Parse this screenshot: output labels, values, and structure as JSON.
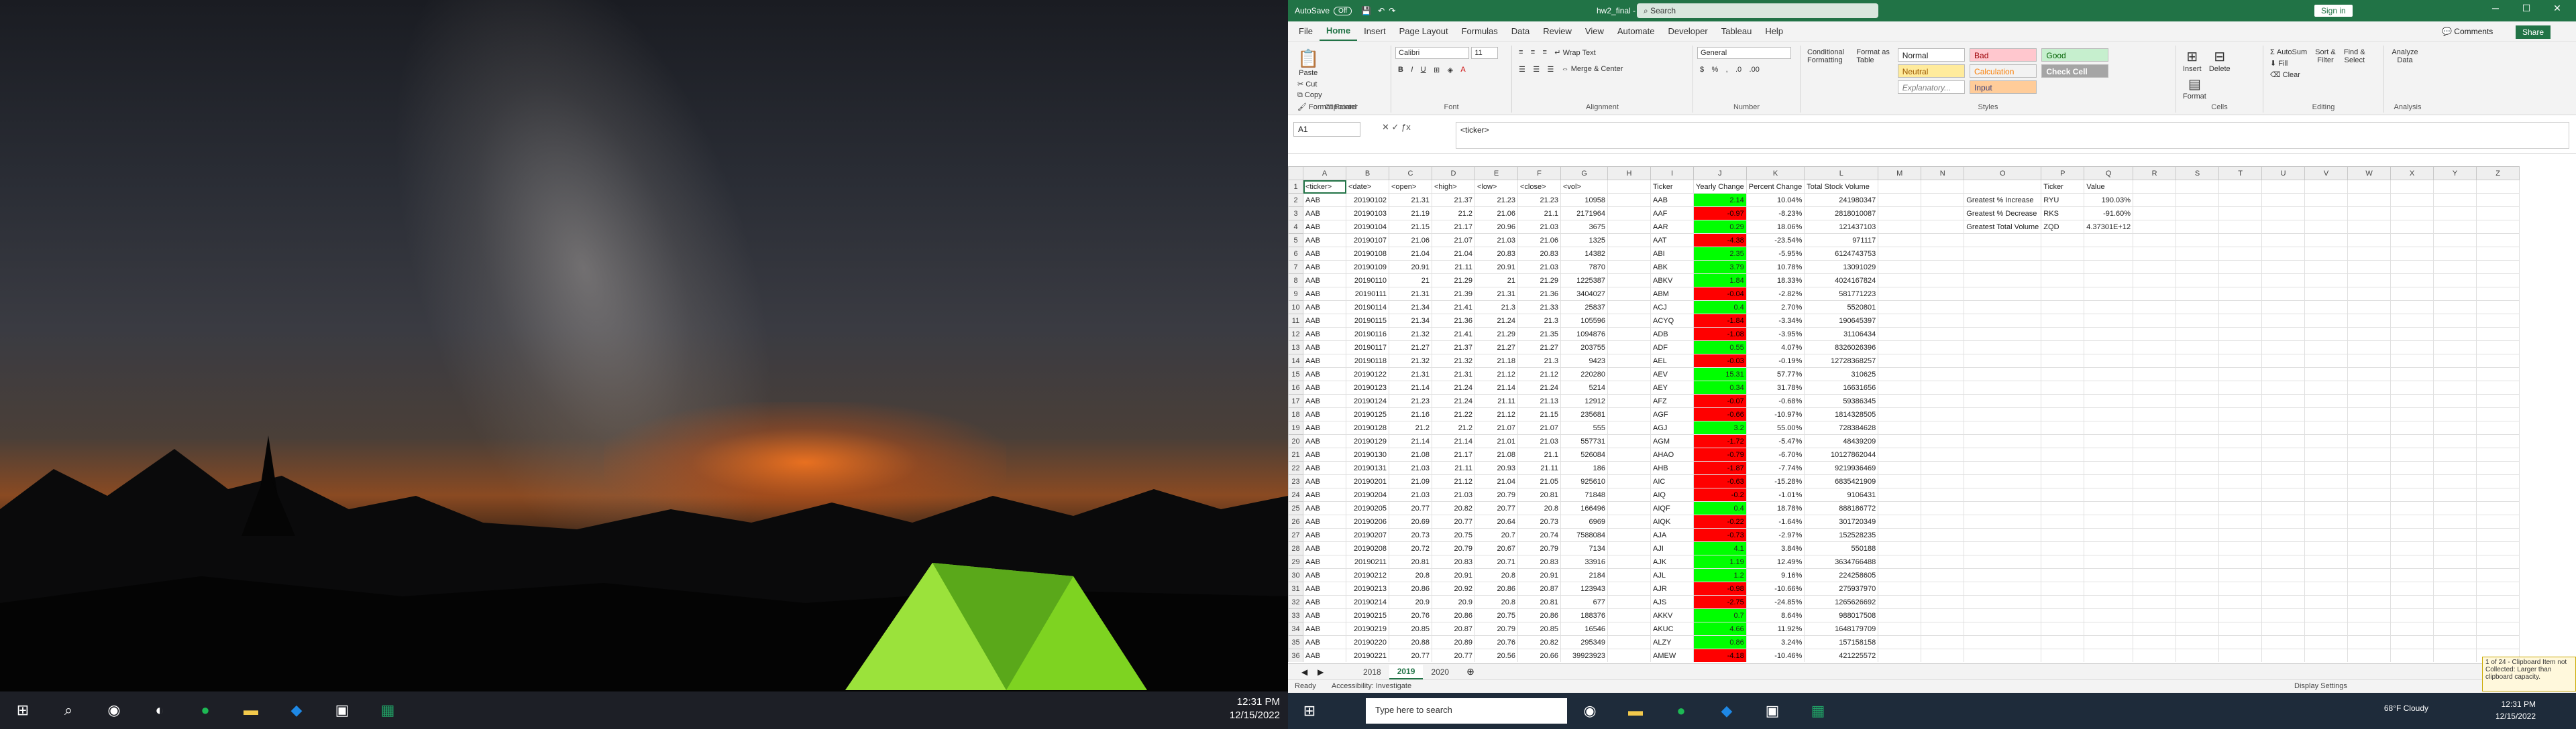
{
  "desktop": {
    "clock_time": "12:31 PM",
    "clock_date": "12/15/2022"
  },
  "excel": {
    "autosave_label": "AutoSave",
    "autosave_state": "Off",
    "filename": "hw2_final - Saved",
    "search_placeholder": "Search",
    "signin_label": "Sign in",
    "menu": [
      "File",
      "Home",
      "Insert",
      "Page Layout",
      "Formulas",
      "Data",
      "Review",
      "View",
      "Automate",
      "Developer",
      "Tableau",
      "Help"
    ],
    "comments_label": "Comments",
    "share_label": "Share",
    "ribbon": {
      "paste": "Paste",
      "cut": "Cut",
      "copy": "Copy",
      "format_painter": "Format Painter",
      "clipboard_group": "Clipboard",
      "font_name": "Calibri",
      "font_size": "11",
      "font_group": "Font",
      "wrap_text": "Wrap Text",
      "merge_center": "Merge & Center",
      "alignment_group": "Alignment",
      "number_format": "General",
      "number_group": "Number",
      "cond_format": "Conditional Formatting",
      "format_table": "Format as Table",
      "cell_styles": [
        "Normal",
        "Bad",
        "Good",
        "Neutral",
        "Calculation",
        "Check Cell",
        "Explanatory...",
        "Input"
      ],
      "styles_group": "Styles",
      "insert": "Insert",
      "delete": "Delete",
      "format": "Format",
      "cells_group": "Cells",
      "autosum": "AutoSum",
      "fill": "Fill",
      "clear": "Clear",
      "sort_filter": "Sort & Filter",
      "find_select": "Find & Select",
      "editing_group": "Editing",
      "analyze": "Analyze Data",
      "analysis_group": "Analysis"
    },
    "name_box": "A1",
    "formula": "<ticker>",
    "columns": [
      "A",
      "B",
      "C",
      "D",
      "E",
      "F",
      "G",
      "H",
      "I",
      "J",
      "K",
      "L",
      "M",
      "N",
      "O",
      "P",
      "Q",
      "R",
      "S",
      "T",
      "U",
      "V",
      "W",
      "X",
      "Y",
      "Z"
    ],
    "headers": [
      "<ticker>",
      "<date>",
      "<open>",
      "<high>",
      "<low>",
      "<close>",
      "<vol>",
      "",
      "Ticker",
      "Yearly Change",
      "Percent Change",
      "Total Stock Volume",
      "",
      "",
      "",
      "Ticker",
      "Value"
    ],
    "rows": [
      [
        "AAB",
        "20190102",
        "21.31",
        "21.37",
        "21.23",
        "21.23",
        "10958",
        "AAB",
        "2.14",
        "10.04%",
        "241980347"
      ],
      [
        "AAB",
        "20190103",
        "21.19",
        "21.2",
        "21.06",
        "21.1",
        "2171964",
        "AAF",
        "-0.97",
        "-8.23%",
        "2818010087"
      ],
      [
        "AAB",
        "20190104",
        "21.15",
        "21.17",
        "20.96",
        "21.03",
        "3675",
        "AAR",
        "0.29",
        "18.06%",
        "121437103"
      ],
      [
        "AAB",
        "20190107",
        "21.06",
        "21.07",
        "21.03",
        "21.06",
        "1325",
        "AAT",
        "-4.38",
        "-23.54%",
        "971117"
      ],
      [
        "AAB",
        "20190108",
        "21.04",
        "21.04",
        "20.83",
        "20.83",
        "14382",
        "ABI",
        "2.35",
        "-5.95%",
        "6124743753"
      ],
      [
        "AAB",
        "20190109",
        "20.91",
        "21.11",
        "20.91",
        "21.03",
        "7870",
        "ABK",
        "3.79",
        "10.78%",
        "13091029"
      ],
      [
        "AAB",
        "20190110",
        "21",
        "21.29",
        "21",
        "21.29",
        "1225387",
        "ABKV",
        "1.84",
        "18.33%",
        "4024167824"
      ],
      [
        "AAB",
        "20190111",
        "21.31",
        "21.39",
        "21.31",
        "21.36",
        "3404027",
        "ABM",
        "-0.04",
        "-2.82%",
        "581771223"
      ],
      [
        "AAB",
        "20190114",
        "21.34",
        "21.41",
        "21.3",
        "21.33",
        "25837",
        "ACJ",
        "0.4",
        "2.70%",
        "5520801"
      ],
      [
        "AAB",
        "20190115",
        "21.34",
        "21.36",
        "21.24",
        "21.3",
        "105596",
        "ACYQ",
        "-1.84",
        "-3.34%",
        "190645397"
      ],
      [
        "AAB",
        "20190116",
        "21.32",
        "21.41",
        "21.29",
        "21.35",
        "1094876",
        "ADB",
        "-1.08",
        "-3.95%",
        "31106434"
      ],
      [
        "AAB",
        "20190117",
        "21.27",
        "21.37",
        "21.27",
        "21.27",
        "203755",
        "ADF",
        "0.55",
        "4.07%",
        "8326026396"
      ],
      [
        "AAB",
        "20190118",
        "21.32",
        "21.32",
        "21.18",
        "21.3",
        "9423",
        "AEL",
        "-0.03",
        "-0.19%",
        "12728368257"
      ],
      [
        "AAB",
        "20190122",
        "21.31",
        "21.31",
        "21.12",
        "21.12",
        "220280",
        "AEV",
        "15.31",
        "57.77%",
        "310625"
      ],
      [
        "AAB",
        "20190123",
        "21.14",
        "21.24",
        "21.14",
        "21.24",
        "5214",
        "AEY",
        "0.34",
        "31.78%",
        "16631656"
      ],
      [
        "AAB",
        "20190124",
        "21.23",
        "21.24",
        "21.11",
        "21.13",
        "12912",
        "AFZ",
        "-0.07",
        "-0.68%",
        "59386345"
      ],
      [
        "AAB",
        "20190125",
        "21.16",
        "21.22",
        "21.12",
        "21.15",
        "235681",
        "AGF",
        "-0.66",
        "-10.97%",
        "1814328505"
      ],
      [
        "AAB",
        "20190128",
        "21.2",
        "21.2",
        "21.07",
        "21.07",
        "555",
        "AGJ",
        "3.2",
        "55.00%",
        "728384628"
      ],
      [
        "AAB",
        "20190129",
        "21.14",
        "21.14",
        "21.01",
        "21.03",
        "557731",
        "AGM",
        "-1.72",
        "-5.47%",
        "48439209"
      ],
      [
        "AAB",
        "20190130",
        "21.08",
        "21.17",
        "21.08",
        "21.1",
        "526084",
        "AHAO",
        "-0.79",
        "-6.70%",
        "10127862044"
      ],
      [
        "AAB",
        "20190131",
        "21.03",
        "21.11",
        "20.93",
        "21.11",
        "186",
        "AHB",
        "-1.87",
        "-7.74%",
        "9219936469"
      ],
      [
        "AAB",
        "20190201",
        "21.09",
        "21.12",
        "21.04",
        "21.05",
        "925610",
        "AIC",
        "-0.63",
        "-15.28%",
        "6835421909"
      ],
      [
        "AAB",
        "20190204",
        "21.03",
        "21.03",
        "20.79",
        "20.81",
        "71848",
        "AIQ",
        "-0.2",
        "-1.01%",
        "9106431"
      ],
      [
        "AAB",
        "20190205",
        "20.77",
        "20.82",
        "20.77",
        "20.8",
        "166496",
        "AIQF",
        "0.4",
        "18.78%",
        "888186772"
      ],
      [
        "AAB",
        "20190206",
        "20.69",
        "20.77",
        "20.64",
        "20.73",
        "6969",
        "AIQK",
        "-0.22",
        "-1.64%",
        "301720349"
      ],
      [
        "AAB",
        "20190207",
        "20.73",
        "20.75",
        "20.7",
        "20.74",
        "7588084",
        "AJA",
        "-0.73",
        "-2.97%",
        "152528235"
      ],
      [
        "AAB",
        "20190208",
        "20.72",
        "20.79",
        "20.67",
        "20.79",
        "7134",
        "AJI",
        "4.1",
        "3.84%",
        "550188"
      ],
      [
        "AAB",
        "20190211",
        "20.81",
        "20.83",
        "20.71",
        "20.83",
        "33916",
        "AJK",
        "1.19",
        "12.49%",
        "3634766488"
      ],
      [
        "AAB",
        "20190212",
        "20.8",
        "20.91",
        "20.8",
        "20.91",
        "2184",
        "AJL",
        "1.2",
        "9.16%",
        "224258605"
      ],
      [
        "AAB",
        "20190213",
        "20.86",
        "20.92",
        "20.86",
        "20.87",
        "123943",
        "AJR",
        "-0.98",
        "-10.66%",
        "275937970"
      ],
      [
        "AAB",
        "20190214",
        "20.9",
        "20.9",
        "20.8",
        "20.81",
        "677",
        "AJS",
        "-2.75",
        "-24.85%",
        "1265626692"
      ],
      [
        "AAB",
        "20190215",
        "20.76",
        "20.86",
        "20.75",
        "20.86",
        "188376",
        "AKKV",
        "0.7",
        "8.64%",
        "988017508"
      ],
      [
        "AAB",
        "20190219",
        "20.85",
        "20.87",
        "20.79",
        "20.85",
        "16546",
        "AKUC",
        "4.66",
        "11.92%",
        "1648179709"
      ],
      [
        "AAB",
        "20190220",
        "20.88",
        "20.89",
        "20.76",
        "20.82",
        "295349",
        "ALZY",
        "0.86",
        "3.24%",
        "157158158"
      ],
      [
        "AAB",
        "20190221",
        "20.77",
        "20.77",
        "20.56",
        "20.66",
        "39923923",
        "AMEW",
        "-4.18",
        "-10.46%",
        "421225572"
      ]
    ],
    "summary": [
      {
        "label": "Greatest % Increase",
        "ticker": "RYU",
        "value": "190.03%"
      },
      {
        "label": "Greatest % Decrease",
        "ticker": "RKS",
        "value": "-91.60%"
      },
      {
        "label": "Greatest Total Volume",
        "ticker": "ZQD",
        "value": "4.37301E+12"
      }
    ],
    "sheets": [
      "2018",
      "2019",
      "2020"
    ],
    "active_sheet": "2019",
    "status_ready": "Ready",
    "status_access": "Accessibility: Investigate",
    "display_settings": "Display Settings",
    "clipboard_note": "1 of 24 - Clipboard  Item not Collected: Larger than clipboard capacity.",
    "taskbar_search": "Type here to search",
    "weather": "68°F  Cloudy",
    "clock_time": "12:31 PM",
    "clock_date": "12/15/2022"
  }
}
